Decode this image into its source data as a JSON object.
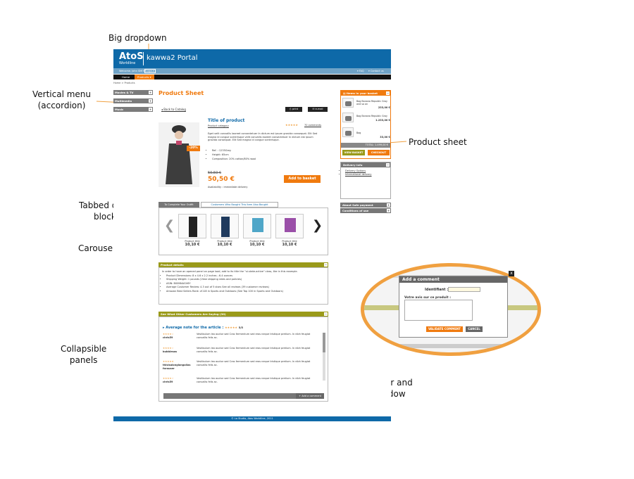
{
  "annotations": {
    "big_dropdown": "Big dropdown",
    "vertical_menu_1": "Vertical menu",
    "vertical_menu_2": "(accordion)",
    "product_sheet": "Product sheet",
    "tabbed_1": "Tabbed data",
    "tabbed_2": "block",
    "carousel": "Carousel",
    "collapsible_1": "Collapsible",
    "collapsible_2": "panels",
    "modal_1": "Modal trigger and",
    "modal_2": "modal window"
  },
  "header": {
    "logo": "AtoS",
    "logo_sub": "Worldline",
    "portal": "kawwa2 Portal",
    "welcome": "Welcome, John SMITH",
    "logout": "Logout",
    "faq": "FAQ",
    "contact": "Contact us"
  },
  "nav": {
    "home": "Home",
    "products": "Products"
  },
  "breadcrumb": "Home > Products",
  "accordion": [
    "Movies & TV",
    "Multimedia",
    "Music"
  ],
  "product": {
    "sheet_title": "Product Sheet",
    "back": "Back to Catalog",
    "print": "print",
    "email": "e-mail",
    "title": "Title of product",
    "category": "Product category",
    "stars": "★★★★★",
    "comments": "70 comments",
    "description": "Eget velit convallis laoreet consectetuer In dictum est ipsum gravida consequat. Elit Sed magna id congue scelerisque velit convallis laoreet consectetuer In dictum est ipsum gravida consequat. Elit Sed magna id congue scelerisque.",
    "ref": "Ref. : 1235Grey",
    "height": "Height: 65cm",
    "composition": "Composition: 20% cotton/80% wool",
    "discount": "-20%",
    "old_price": "50,50 €",
    "price": "50,50 €",
    "add_to_basket": "Add to basket",
    "availability": "Availability : immediate delivery"
  },
  "tabs": [
    "To Complete Your Outfit",
    "Customers Who Bought This Item Also Bought"
  ],
  "carousel": {
    "prev": "❮",
    "next": "❯",
    "items": [
      {
        "title": "Product title",
        "price": "10,10 €",
        "color": "#222222"
      },
      {
        "title": "Product title",
        "price": "10,10 €",
        "color": "#1f3a5e"
      },
      {
        "title": "Product title",
        "price": "10,10 €",
        "color": "#4fa6c8"
      },
      {
        "title": "Product title",
        "price": "10,10 €",
        "color": "#9a4fa8"
      }
    ]
  },
  "details": {
    "title": "Product details",
    "intro": "In order to have an opened panel on page load, add to its title the \"ui-state-active\" class, like in this example.",
    "bullets": [
      "Product Dimensions: 8 x 4.6 x 2.2 inches ; 6.4 ounces",
      "Shipping Weight: 1 pounds (View shipping rates and policies)",
      "ASIN: B00NNAGV6Y",
      "Average Customer Review: 4.3 out of 5 stars See all reviews (39 customer reviews)",
      "Amazon Best Sellers Rank: #118 in Sports and Outdoors (See Top 100 in Sports and Outdoors)"
    ]
  },
  "reviews": {
    "title": "See What Other Customers Are Saying (30)",
    "average_label": "Average note for the article :",
    "average_value": "5/5",
    "items": [
      {
        "stars": "★★★★☆",
        "user": "chris59",
        "text": "Vestibulum leo auctor sed Cras fermentum sed eros neque tristique pretium. In nibh feugiat convallis felis ac."
      },
      {
        "stars": "★★★★☆",
        "user": "bubblesas",
        "text": "Vestibulum leo auctor sed Cras fermentum sed eros neque tristique pretium. In nibh feugiat convallis felis ac."
      },
      {
        "stars": "★★★★★",
        "user": "thisisalonglongalias forauser",
        "text": "Vestibulum leo auctor sed Cras fermentum sed eros neque tristique pretium. In nibh feugiat convallis felis ac."
      },
      {
        "stars": "★★★★☆",
        "user": "chris59",
        "text": "Vestibulum leo auctor sed Cras fermentum sed eros neque tristique pretium. In nibh feugiat convallis felis ac."
      }
    ],
    "add_comment": "+ Add a comment"
  },
  "basket": {
    "title": "Items in your basket",
    "items": [
      {
        "name": "Bag Banana Republic Gray and so on",
        "price": "233,00 €"
      },
      {
        "name": "Bag Banana Republic Gray",
        "price": "1.233,00 €"
      },
      {
        "name": "Bag",
        "price": "33,00 €"
      }
    ],
    "total": "TOTAL: 1.499,00 €",
    "view": "VIEW BASKET",
    "checkout": "CHECKOUT"
  },
  "delivery": {
    "title": "Delivery Info",
    "links": [
      "Delivery Options",
      "International delivery"
    ]
  },
  "side_panels": [
    "About Safe payment",
    "Conditions of use"
  ],
  "footer": "© La Studio, Atos Worldline, 2011",
  "modal": {
    "title": "Add a comment",
    "close": "x",
    "identifier_label": "Identifiant :",
    "comment_label": "Votre avis sur ce produit :",
    "validate": "VALIDATE COMMENT",
    "cancel": "CANCEL"
  },
  "colors": {
    "brand_blue": "#0e69a8",
    "accent_orange": "#f07a0e",
    "panel_olive": "#9a9a1a"
  }
}
